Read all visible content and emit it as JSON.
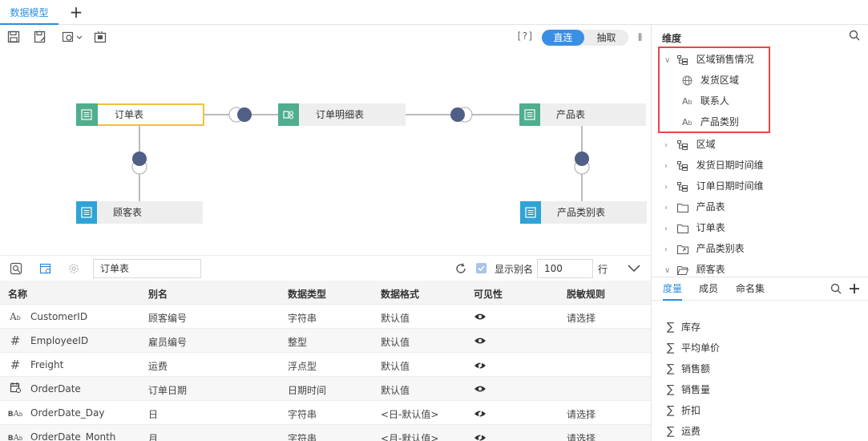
{
  "tabs": {
    "active_label": "数据模型",
    "add_label": "+"
  },
  "toolbar": {
    "help": "[?]",
    "direct_label": "直连",
    "extract_label": "抽取",
    "more": "⫼"
  },
  "model": {
    "tables": [
      {
        "name": "订单表",
        "icon": "table-icon",
        "color": "#4fae8c"
      },
      {
        "name": "订单明细表",
        "icon": "detail-table-icon",
        "color": "#4fae8c"
      },
      {
        "name": "产品表",
        "icon": "table-icon",
        "color": "#4fae8c"
      },
      {
        "name": "顾客表",
        "icon": "table-icon",
        "color": "#2fa3d6"
      },
      {
        "name": "产品类别表",
        "icon": "table-icon",
        "color": "#2fa3d6"
      }
    ]
  },
  "grid_toolbar": {
    "search_value": "订单表",
    "show_alias_label": "显示别名",
    "rows_value": "100",
    "rows_unit": "行"
  },
  "grid": {
    "headers": [
      "名称",
      "别名",
      "数据类型",
      "数据格式",
      "可见性",
      "脱敏规则"
    ],
    "rows": [
      {
        "type_icon": "Ab",
        "name": "CustomerID",
        "alias": "顾客编号",
        "dtype": "字符串",
        "format": "默认值",
        "visible": "eye-icon",
        "mask": "请选择"
      },
      {
        "type_icon": "#",
        "name": "EmployeeID",
        "alias": "雇员编号",
        "dtype": "整型",
        "format": "默认值",
        "visible": "eye-icon",
        "mask": ""
      },
      {
        "type_icon": "#",
        "name": "Freight",
        "alias": "运费",
        "dtype": "浮点型",
        "format": "默认值",
        "visible": "eye-hidden-icon",
        "mask": ""
      },
      {
        "type_icon": "date",
        "name": "OrderDate",
        "alias": "订单日期",
        "dtype": "日期时间",
        "format": "默认值",
        "visible": "eye-icon",
        "mask": ""
      },
      {
        "type_icon": "BAb",
        "name": "OrderDate_Day",
        "alias": "日",
        "dtype": "字符串",
        "format": "<日-默认值>",
        "visible": "eye-hidden-icon",
        "mask": "请选择"
      },
      {
        "type_icon": "BAb",
        "name": "OrderDate_Month",
        "alias": "月",
        "dtype": "字符串",
        "format": "<月-默认值>",
        "visible": "eye-hidden-icon",
        "mask": "请选择"
      }
    ]
  },
  "dimensions": {
    "title": "维度",
    "tree": [
      {
        "label": "区域销售情况",
        "kind": "hierarchy",
        "expanded": true,
        "level": 0
      },
      {
        "label": "发货区域",
        "kind": "geo",
        "level": 1
      },
      {
        "label": "联系人",
        "kind": "text",
        "level": 1
      },
      {
        "label": "产品类别",
        "kind": "text",
        "level": 1
      },
      {
        "label": "区域",
        "kind": "hierarchy",
        "expanded": false,
        "level": 0
      },
      {
        "label": "发货日期时间维",
        "kind": "hierarchy",
        "expanded": false,
        "level": 0
      },
      {
        "label": "订单日期时间维",
        "kind": "hierarchy",
        "expanded": false,
        "level": 0
      },
      {
        "label": "产品表",
        "kind": "folder",
        "expanded": false,
        "level": 0
      },
      {
        "label": "订单表",
        "kind": "folder",
        "expanded": false,
        "level": 0
      },
      {
        "label": "产品类别表",
        "kind": "folder-link",
        "expanded": false,
        "level": 0
      },
      {
        "label": "顾客表",
        "kind": "folder",
        "expanded": true,
        "level": 0
      }
    ]
  },
  "measures": {
    "tabs": [
      "度量",
      "成员",
      "命名集"
    ],
    "items": [
      "库存",
      "平均单价",
      "销售额",
      "销售量",
      "折扣",
      "运费"
    ]
  }
}
